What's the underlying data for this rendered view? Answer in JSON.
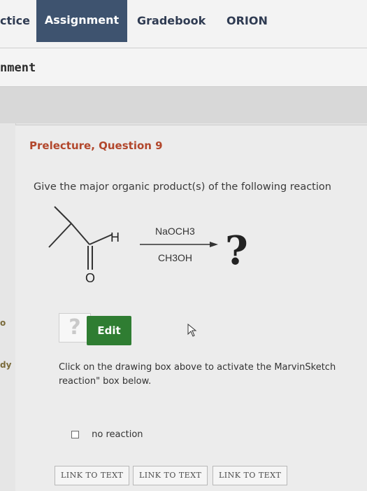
{
  "nav": {
    "tabs": [
      {
        "label": "ctice",
        "active": false
      },
      {
        "label": "Assignment",
        "active": true
      },
      {
        "label": "Gradebook",
        "active": false
      },
      {
        "label": "ORION",
        "active": false
      }
    ]
  },
  "header": {
    "title": "nment"
  },
  "sidebar": {
    "marks": [
      "o",
      "dy"
    ]
  },
  "question": {
    "title": "Prelecture, Question 9",
    "text": "Give the major organic product(s) of the following reaction",
    "reaction": {
      "aldehyde_h": "H",
      "carbonyl_o": "O",
      "reagent_top": "NaOCH3",
      "reagent_bottom": "CH3OH",
      "product": "?"
    }
  },
  "toolbar": {
    "help_label": "?",
    "edit_label": "Edit"
  },
  "instructions": {
    "line1": "Click on the drawing box above to activate the MarvinSketch",
    "line2": "reaction\" box below."
  },
  "options": {
    "no_reaction_label": "no reaction",
    "no_reaction_checked": false
  },
  "links": [
    "LINK TO TEXT",
    "LINK TO TEXT",
    "LINK TO TEXT"
  ],
  "colors": {
    "accent_tab": "#3e536f",
    "title_red": "#b2472c",
    "edit_green": "#2f7d32"
  }
}
